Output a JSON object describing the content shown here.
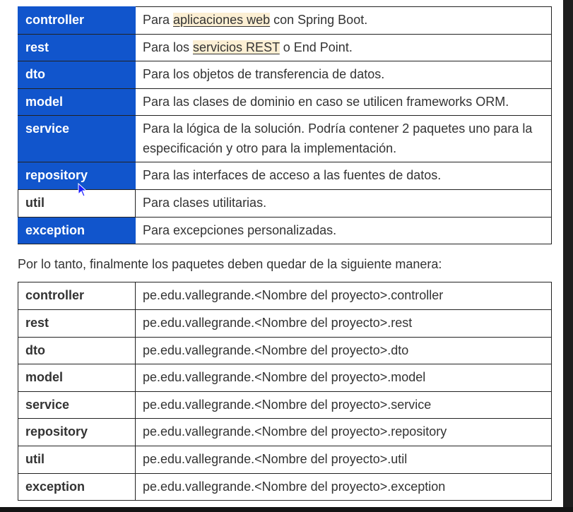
{
  "packages_table": [
    {
      "name": "controller",
      "highlight": true,
      "pre": "Para ",
      "link": "aplicaciones web",
      "post": " con Spring Boot."
    },
    {
      "name": "rest",
      "highlight": true,
      "pre": "Para los ",
      "link": "servicios REST",
      "post": " o End Point."
    },
    {
      "name": "dto",
      "highlight": true,
      "pre": "Para los objetos de transferencia de datos.",
      "link": "",
      "post": ""
    },
    {
      "name": "model",
      "highlight": true,
      "pre": "Para las clases de dominio en caso se utilicen frameworks ORM.",
      "link": "",
      "post": ""
    },
    {
      "name": "service",
      "highlight": true,
      "pre": "Para la lógica de la solución. Podría contener 2 paquetes uno para la especificación y otro para la implementación.",
      "link": "",
      "post": ""
    },
    {
      "name": "repository",
      "highlight": true,
      "pre": "Para las interfaces de acceso a las fuentes de datos.",
      "link": "",
      "post": ""
    },
    {
      "name": "util",
      "highlight": false,
      "pre": "Para clases utilitarias.",
      "link": "",
      "post": ""
    },
    {
      "name": "exception",
      "highlight": true,
      "pre": "Para excepciones personalizadas.",
      "link": "",
      "post": ""
    }
  ],
  "intro_text": "Por lo tanto, finalmente los paquetes deben quedar de la siguiente manera:",
  "paths_table": [
    {
      "name": "controller",
      "path": "pe.edu.vallegrande.<Nombre del proyecto>.controller"
    },
    {
      "name": "rest",
      "path": "pe.edu.vallegrande.<Nombre del proyecto>.rest"
    },
    {
      "name": "dto",
      "path": "pe.edu.vallegrande.<Nombre del proyecto>.dto"
    },
    {
      "name": "model",
      "path": "pe.edu.vallegrande.<Nombre del proyecto>.model"
    },
    {
      "name": "service",
      "path": "pe.edu.vallegrande.<Nombre del proyecto>.service"
    },
    {
      "name": "repository",
      "path": "pe.edu.vallegrande.<Nombre del proyecto>.repository"
    },
    {
      "name": "util",
      "path": "pe.edu.vallegrande.<Nombre del proyecto>.util"
    },
    {
      "name": "exception",
      "path": "pe.edu.vallegrande.<Nombre del proyecto>.exception"
    }
  ],
  "colors": {
    "selection_blue": "#1155cc",
    "link_highlight": "#fcefd3",
    "text": "#333333",
    "frame": "#000000"
  },
  "icons": {
    "cursor": "mouse-pointer-icon"
  }
}
